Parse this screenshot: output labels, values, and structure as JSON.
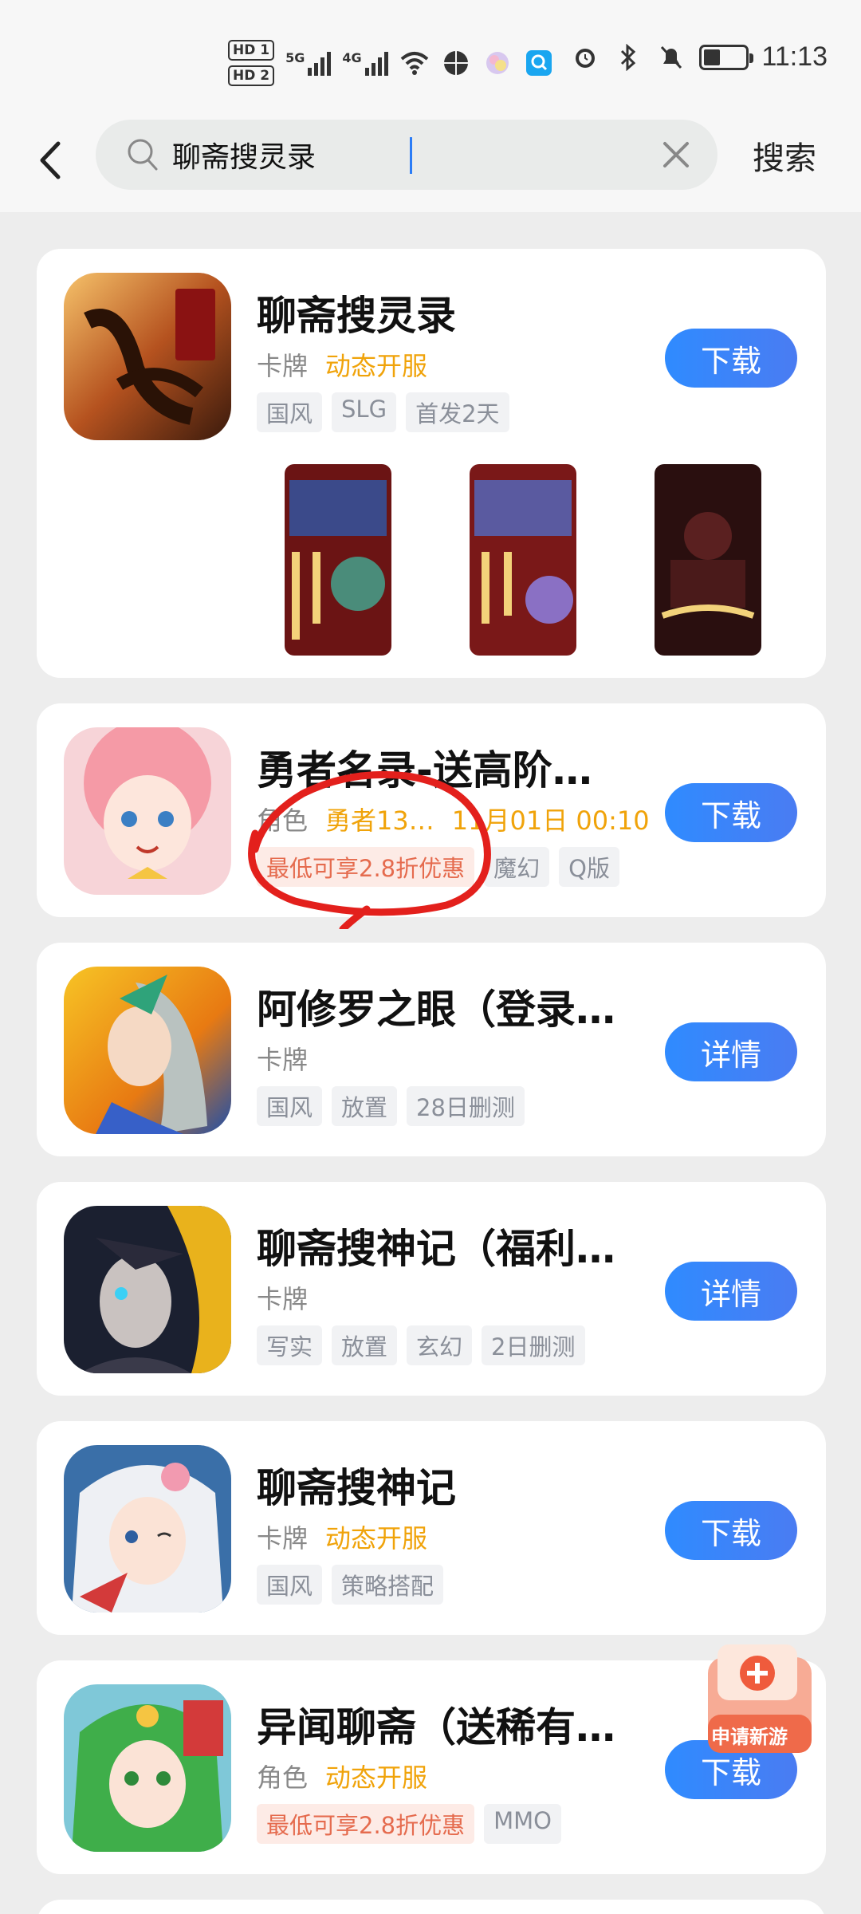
{
  "status_bar": {
    "hd1": "HD 1",
    "hd2": "HD 2",
    "net1": "5G",
    "net2": "4G",
    "time": "11:13"
  },
  "search": {
    "query": "聊斋搜灵录",
    "search_label": "搜索"
  },
  "results": [
    {
      "title": "聊斋搜灵录",
      "category": "卡牌",
      "promo": "动态开服",
      "tags": [
        "国风",
        "SLG",
        "首发2天"
      ],
      "action": "下载"
    },
    {
      "title": "勇者名录-送高阶…",
      "category": "角色",
      "promo": "勇者13…",
      "promo_time": "11月01日 00:10",
      "tags": [
        "最低可享2.8折优惠",
        "魔幻",
        "Q版"
      ],
      "action": "下载"
    },
    {
      "title": "阿修罗之眼（登录…",
      "category": "卡牌",
      "promo": "",
      "tags": [
        "国风",
        "放置",
        "28日删测"
      ],
      "action": "详情"
    },
    {
      "title": "聊斋搜神记（福利…",
      "category": "卡牌",
      "promo": "",
      "tags": [
        "写实",
        "放置",
        "玄幻",
        "2日删测"
      ],
      "action": "详情"
    },
    {
      "title": "聊斋搜神记",
      "category": "卡牌",
      "promo": "动态开服",
      "tags": [
        "国风",
        "策略搭配"
      ],
      "action": "下载"
    },
    {
      "title": "异闻聊斋（送稀有…",
      "category": "角色",
      "promo": "动态开服",
      "tags": [
        "最低可享2.8折优惠",
        "MMO"
      ],
      "action": "下载"
    }
  ],
  "float_button": {
    "label": "申请新游"
  },
  "colors": {
    "accent": "#2f8bff",
    "promo": "#f0a30a",
    "annotation": "#e3201c"
  }
}
